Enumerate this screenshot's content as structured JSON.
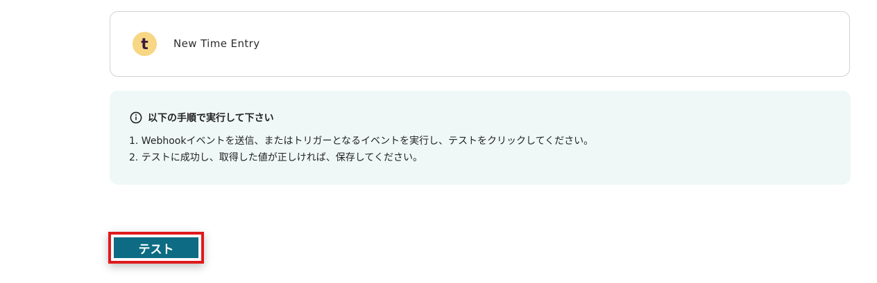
{
  "trigger": {
    "app_icon": "toggl-track-icon",
    "icon_letter": "t",
    "icon_bg_color": "#f7d684",
    "icon_letter_color": "#3b1a3e",
    "label": "New Time Entry"
  },
  "info": {
    "icon": "info-circle-icon",
    "title": "以下の手順で実行して下さい",
    "steps": [
      "1. Webhookイベントを送信、またはトリガーとなるイベントを実行し、テストをクリックしてください。",
      "2. テストに成功し、取得した値が正しければ、保存してください。"
    ],
    "background_color": "#eff8f7"
  },
  "test_button": {
    "label": "テスト",
    "color": "#0d6c83",
    "highlight_color": "#e0191c"
  }
}
